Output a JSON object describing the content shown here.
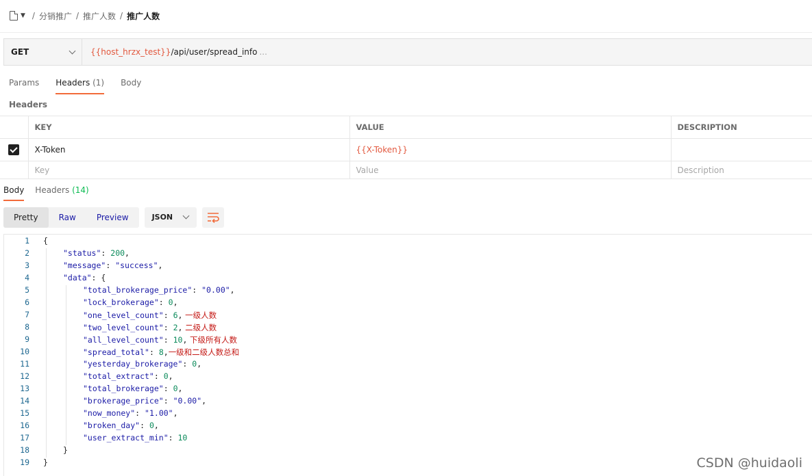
{
  "breadcrumb": {
    "items": [
      "分销推广",
      "推广人数"
    ],
    "current": "推广人数",
    "separator": "/"
  },
  "request": {
    "method": "GET",
    "url_variable": "{{host_hrzx_test}}",
    "url_path": "/api/user/spread_info",
    "url_ellipsis": "..."
  },
  "request_tabs": [
    {
      "label": "Params",
      "count": ""
    },
    {
      "label": "Headers",
      "count": "(1)"
    },
    {
      "label": "Body",
      "count": ""
    }
  ],
  "headers_section": {
    "title": "Headers",
    "columns": [
      "KEY",
      "VALUE",
      "DESCRIPTION"
    ],
    "rows": [
      {
        "checked": true,
        "key": "X-Token",
        "value": "{{X-Token}}",
        "description": ""
      }
    ],
    "placeholders": {
      "key": "Key",
      "value": "Value",
      "description": "Description"
    }
  },
  "response_tabs": [
    {
      "label": "Body",
      "count": ""
    },
    {
      "label": "Headers",
      "count": "(14)"
    }
  ],
  "view_modes": [
    "Pretty",
    "Raw",
    "Preview"
  ],
  "format": "JSON",
  "code_lines": [
    {
      "n": "1",
      "indent": 0,
      "t": "{"
    },
    {
      "n": "2",
      "indent": 1,
      "t": "\"status\": 200,"
    },
    {
      "n": "3",
      "indent": 1,
      "t": "\"message\": \"success\","
    },
    {
      "n": "4",
      "indent": 1,
      "t": "\"data\": {"
    },
    {
      "n": "5",
      "indent": 2,
      "t": "\"total_brokerage_price\": \"0.00\","
    },
    {
      "n": "6",
      "indent": 2,
      "t": "\"lock_brokerage\": 0,"
    },
    {
      "n": "7",
      "indent": 2,
      "t": "\"one_level_count\": 6,",
      "note": " 一级人数"
    },
    {
      "n": "8",
      "indent": 2,
      "t": "\"two_level_count\": 2,",
      "note": " 二级人数"
    },
    {
      "n": "9",
      "indent": 2,
      "t": "\"all_level_count\": 10,",
      "note": " 下级所有人数"
    },
    {
      "n": "10",
      "indent": 2,
      "t": "\"spread_total\": 8,",
      "note": "一级和二级人数总和"
    },
    {
      "n": "11",
      "indent": 2,
      "t": "\"yesterday_brokerage\": 0,"
    },
    {
      "n": "12",
      "indent": 2,
      "t": "\"total_extract\": 0,"
    },
    {
      "n": "13",
      "indent": 2,
      "t": "\"total_brokerage\": 0,"
    },
    {
      "n": "14",
      "indent": 2,
      "t": "\"brokerage_price\": \"0.00\","
    },
    {
      "n": "15",
      "indent": 2,
      "t": "\"now_money\": \"1.00\","
    },
    {
      "n": "16",
      "indent": 2,
      "t": "\"broken_day\": 0,"
    },
    {
      "n": "17",
      "indent": 2,
      "t": "\"user_extract_min\": 10"
    },
    {
      "n": "18",
      "indent": 1,
      "t": "}"
    },
    {
      "n": "19",
      "indent": 0,
      "t": "}"
    }
  ],
  "watermark": "CSDN @huidaoli",
  "colors": {
    "accent": "#f26b3a",
    "variable": "#e2583e",
    "count_green": "#0cbb52"
  }
}
